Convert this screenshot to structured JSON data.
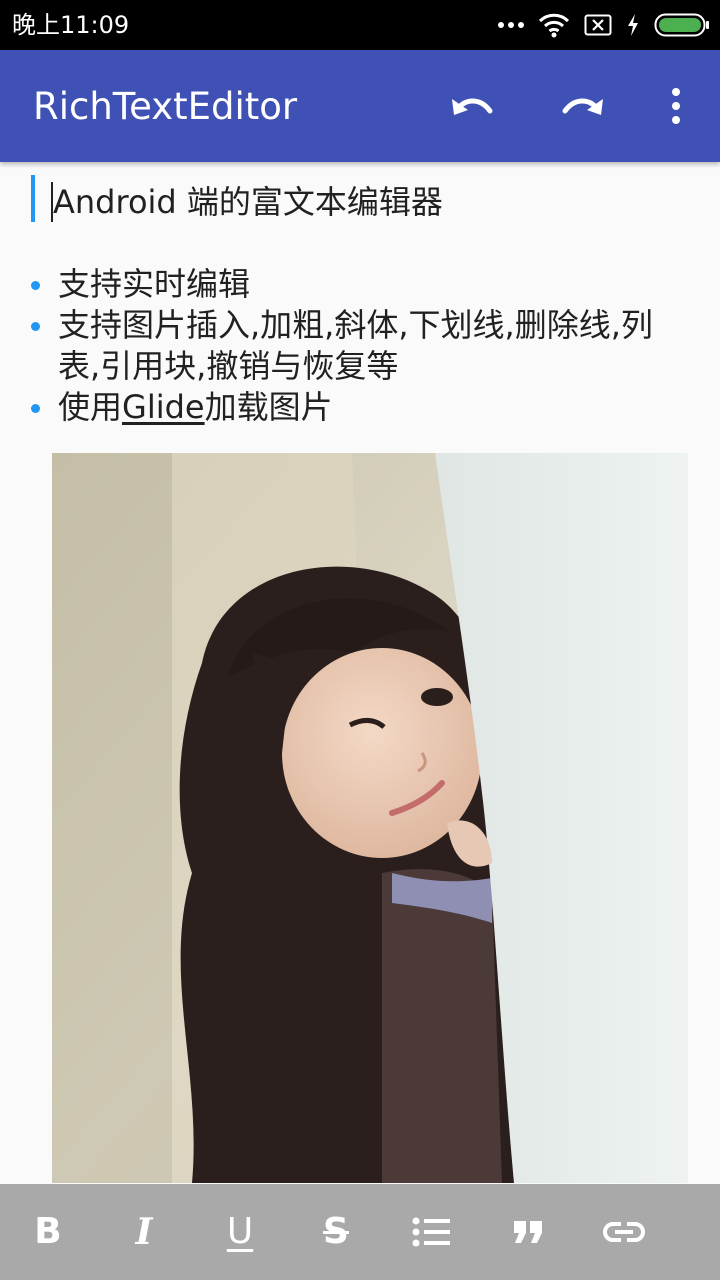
{
  "status_bar": {
    "time": "晚上11:09",
    "icons": [
      "more-dots-icon",
      "wifi-icon",
      "sim-disabled-icon",
      "charging-icon",
      "battery-icon"
    ]
  },
  "app_bar": {
    "title": "RichTextEditor",
    "actions": [
      "undo-icon",
      "redo-icon",
      "overflow-menu-icon"
    ],
    "color": "#3f51b5"
  },
  "editor": {
    "quote_text": "Android 端的富文本编辑器",
    "bullets": [
      {
        "text": "支持实时编辑"
      },
      {
        "text": "支持图片插入,加粗,斜体,下划线,删除线,列表,引用块,撤销与恢复等"
      },
      {
        "before": "使用",
        "link": "Glide",
        "after": "加载图片"
      }
    ],
    "accent_color": "#2196f3",
    "image": "photo-of-girl-peeking-behind-wall"
  },
  "toolbar": {
    "bold_label": "B",
    "italic_label": "I",
    "underline_label": "U",
    "strike_label": "S",
    "buttons": [
      "bold-icon",
      "italic-icon",
      "underline-icon",
      "strikethrough-icon",
      "bulleted-list-icon",
      "quote-icon",
      "link-icon"
    ],
    "background": "#a9a9a9"
  }
}
